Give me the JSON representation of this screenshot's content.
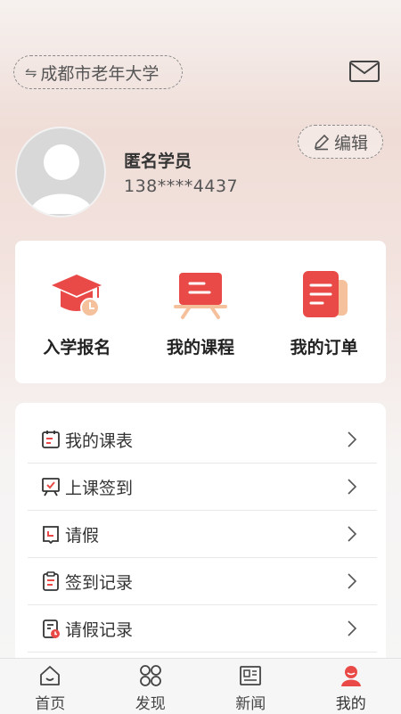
{
  "header": {
    "school_name": "成都市老年大学",
    "switch_icon": "swap-icon",
    "message_icon": "mail-icon"
  },
  "profile": {
    "name": "匿名学员",
    "phone": "138****4437",
    "edit_label": "编辑",
    "avatar_icon": "default-avatar-icon"
  },
  "quick_actions": [
    {
      "label": "入学报名",
      "icon": "graduation-cap-icon"
    },
    {
      "label": "我的课程",
      "icon": "blackboard-icon"
    },
    {
      "label": "我的订单",
      "icon": "order-document-icon"
    }
  ],
  "menu": [
    {
      "label": "我的课表",
      "icon": "calendar-icon"
    },
    {
      "label": "上课签到",
      "icon": "checkin-board-icon"
    },
    {
      "label": "请假",
      "icon": "leave-book-icon"
    },
    {
      "label": "签到记录",
      "icon": "clipboard-icon"
    },
    {
      "label": "请假记录",
      "icon": "leave-record-icon"
    }
  ],
  "tabbar": [
    {
      "label": "首页",
      "icon": "home-icon",
      "active": false
    },
    {
      "label": "发现",
      "icon": "discover-icon",
      "active": false
    },
    {
      "label": "新闻",
      "icon": "news-icon",
      "active": false
    },
    {
      "label": "我的",
      "icon": "profile-icon",
      "active": true
    }
  ],
  "colors": {
    "accent": "#e94a47",
    "accent_light": "#f5c19c",
    "icon_dark": "#333333"
  }
}
